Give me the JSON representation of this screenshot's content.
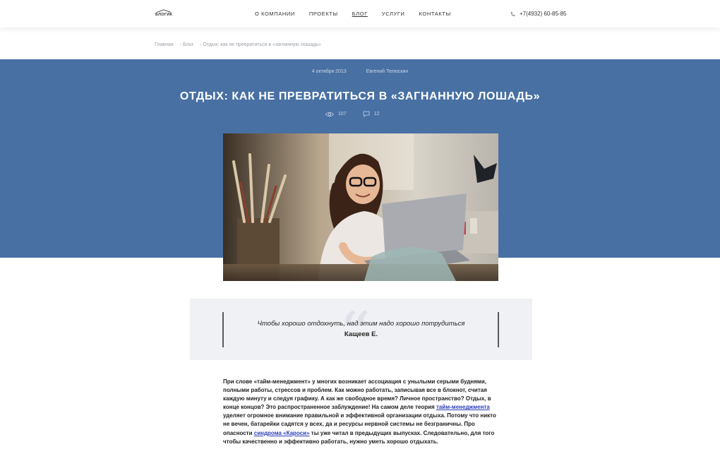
{
  "header": {
    "logo_text": "БЛОГИК",
    "nav": [
      {
        "label": "О КОМПАНИИ",
        "active": false
      },
      {
        "label": "ПРОЕКТЫ",
        "active": false
      },
      {
        "label": "БЛОГ",
        "active": true
      },
      {
        "label": "УСЛУГИ",
        "active": false
      },
      {
        "label": "КОНТАКТЫ",
        "active": false
      }
    ],
    "phone": "+7(4932) 60-85-85",
    "phone_icon": "phone-icon"
  },
  "breadcrumbs": [
    {
      "label": "Главная"
    },
    {
      "label": "Блог"
    },
    {
      "label": "Отдых: как не превратиться в «загнанную лошадь»"
    }
  ],
  "post": {
    "date": "4 октября 2013",
    "author": "Евгений Телюскин",
    "title": "ОТДЫХ: КАК НЕ ПРЕВРАТИТЬСЯ В «ЗАГНАННУЮ ЛОШАДЬ»",
    "views": "107",
    "comments": "12",
    "views_icon": "eye-icon",
    "comments_icon": "comment-icon"
  },
  "quote": {
    "text": "Чтобы хорошо отдохнуть, над этим надо хорошо потрудиться",
    "author": "Кащеев Е."
  },
  "article": {
    "p1": "При слове «тайм-менеджмент» у многих возникает ассоциация с унылыми серыми буднями, полными работы, стрессов и проблем. Как можно работать, записывая все в блокнот, считая каждую минуту и следуя графику. А как же свободное время? Личное пространство? Отдых, в конце концов? Это распространенное заблуждение! На самом деле теория ",
    "link1": "тайм-менеджмента",
    "p2": " уделяет огромное внимание правильной и эффективной организации отдыха. Потому что никто не вечен, батарейки садятся у всех, да и ресурсы нервной системы не безграничны. Про опасности ",
    "link2": "синдрома «Кароси»",
    "p3": " ты уже читал в предыдущих выпусках. Следовательно, для того чтобы качественно и эффективно работать, нужно уметь хорошо отдыхать."
  },
  "colors": {
    "hero": "#4870a3",
    "quote_bg": "#f0f1f4",
    "link": "#2d3db8"
  }
}
